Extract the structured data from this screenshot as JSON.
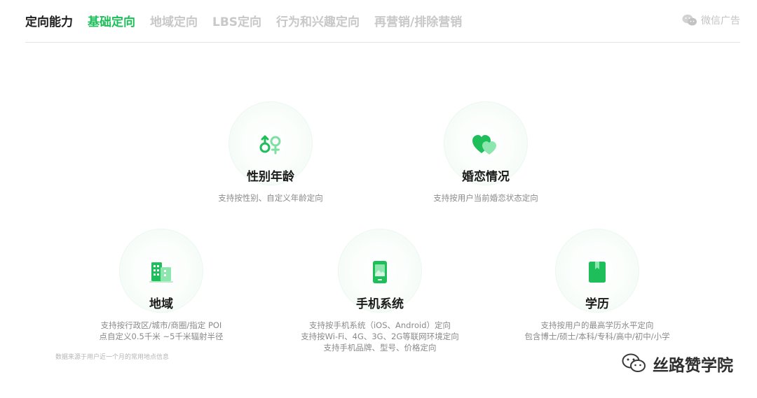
{
  "header": {
    "title": "定向能力",
    "tabs": [
      {
        "label": "基础定向",
        "active": true
      },
      {
        "label": "地域定向",
        "active": false
      },
      {
        "label": "LBS定向",
        "active": false
      },
      {
        "label": "行为和兴趣定向",
        "active": false
      },
      {
        "label": "再营销/排除营销",
        "active": false
      }
    ],
    "brand": "微信广告"
  },
  "features": [
    {
      "title": "性别年龄",
      "desc": [
        "支持按性别、自定义年龄定向"
      ],
      "icon": "gender-symbol-icon"
    },
    {
      "title": "婚恋情况",
      "desc": [
        "支持按用户当前婚恋状态定向"
      ],
      "icon": "hearts-icon"
    },
    {
      "title": "地域",
      "desc": [
        "支持按行政区/城市/商圈/指定 POI",
        "点自定义0.5千米 ~5千米辐射半径"
      ],
      "note": "数据来源于用户近一个月的常用地点信息",
      "icon": "buildings-icon"
    },
    {
      "title": "手机系统",
      "desc": [
        "支持按手机系统（iOS、Android）定向",
        "支持按Wi-Fi、4G、3G、2G等联网环境定向",
        "支持手机品牌、型号、价格定向"
      ],
      "icon": "phone-icon"
    },
    {
      "title": "学历",
      "desc": [
        "支持按用户的最高学历水平定向",
        "包含博士/硕士/本科/专科/高中/初中/小学"
      ],
      "icon": "book-icon"
    }
  ],
  "watermark": "丝路赞学院",
  "colors": {
    "accent": "#1ebf5b",
    "inactive_tab": "#c8c8c8",
    "desc": "#8a8a8a"
  }
}
